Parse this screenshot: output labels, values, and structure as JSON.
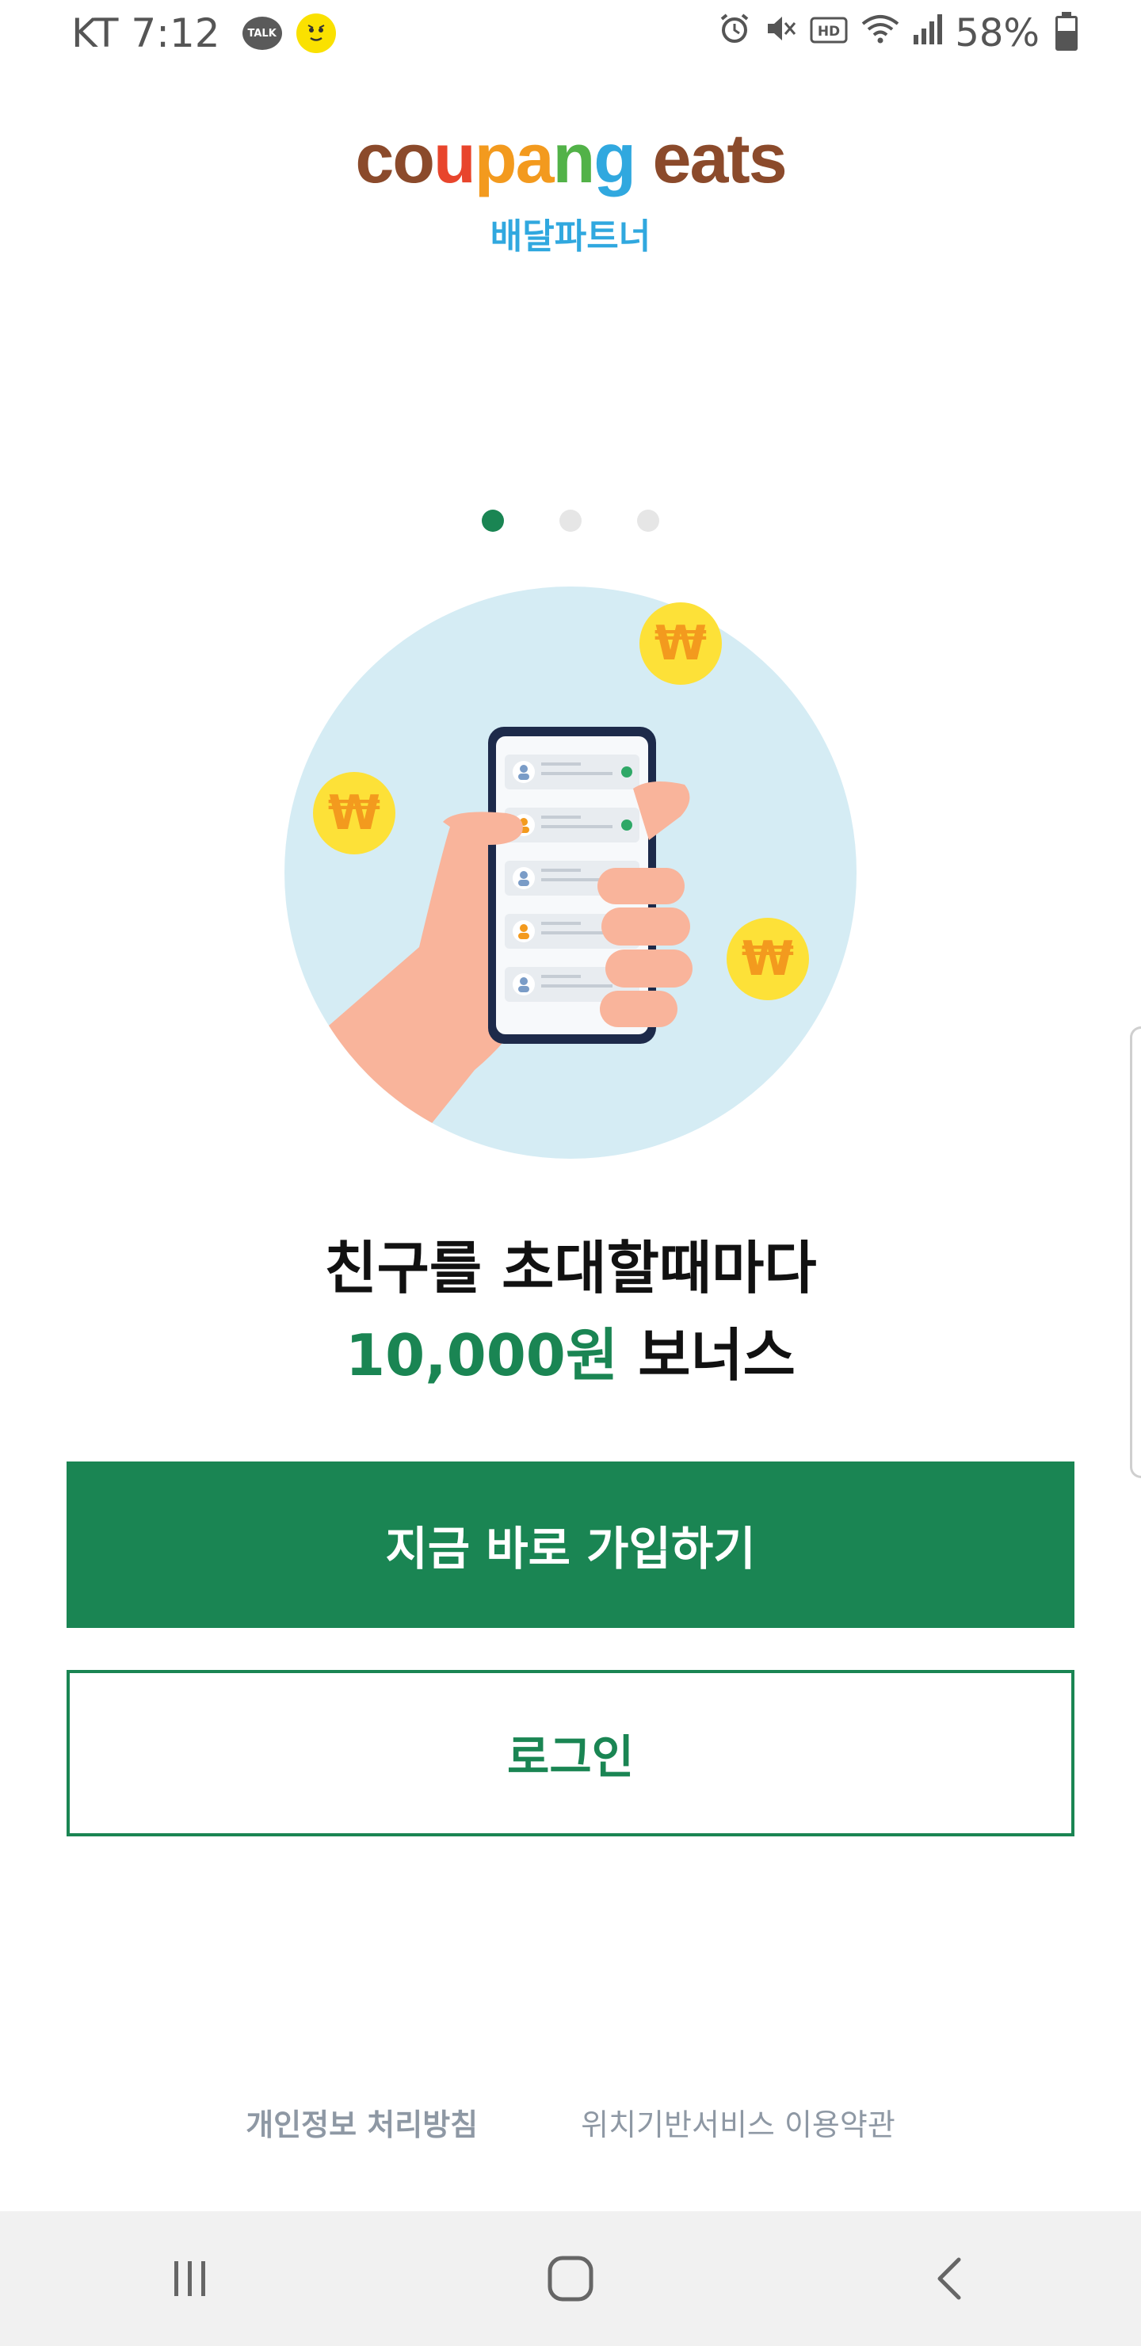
{
  "status_bar": {
    "carrier_time": "KT 7:12",
    "talk_badge": "TALK",
    "battery": "58%",
    "hd_label": "HD"
  },
  "brand": {
    "logo": "coupang eats",
    "subtitle": "배달파트너",
    "colors": {
      "logo_brown": "#8b4a2b",
      "logo_red": "#e8452c",
      "logo_orange": "#f39a1e",
      "logo_green": "#52b248",
      "logo_blue": "#30a8df",
      "subtitle": "#30a8df"
    }
  },
  "carousel": {
    "page_count": 3,
    "active_index": 0
  },
  "illustration": {
    "coin_symbol": "₩",
    "icons": [
      "phone-in-hand-illustration",
      "won-coin-icon"
    ]
  },
  "headline": {
    "line1": "친구를 초대할때마다",
    "amount": "10,000원",
    "suffix": " 보너스"
  },
  "buttons": {
    "signup": "지금 바로 가입하기",
    "login": "로그인"
  },
  "footer": {
    "privacy_policy": "개인정보 처리방침",
    "location_terms": "위치기반서비스 이용약관"
  },
  "theme": {
    "primary_green": "#1a8553",
    "inactive_dot": "#e6e6e6",
    "footer_text": "#8e98a4"
  }
}
